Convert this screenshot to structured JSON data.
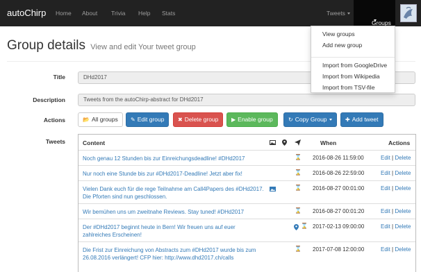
{
  "navbar": {
    "brand": "autoChirp",
    "items": [
      "Home",
      "About",
      "Trivia",
      "Help",
      "Stats"
    ],
    "tweets_label": "Tweets",
    "groups_label": "Groups",
    "accent": "#222222"
  },
  "dropdown": {
    "items": [
      "View groups",
      "Add new group",
      "Import from GoogleDrive",
      "Import from Wikipedia",
      "Import from TSV-file"
    ]
  },
  "header": {
    "title": "Group details",
    "subtitle": "View and edit Your tweet group"
  },
  "form": {
    "title_label": "Title",
    "title_value": "DHd2017",
    "description_label": "Description",
    "description_value": "Tweets from the autoChirp-abstract for DHd2017",
    "actions_label": "Actions",
    "tweets_label": "Tweets"
  },
  "buttons": {
    "all_groups": "All groups",
    "edit_group": "Edit group",
    "delete_group": "Delete group",
    "enable_group": "Enable group",
    "copy_group": "Copy Group",
    "add_tweet": "Add tweet"
  },
  "table": {
    "headers": {
      "content": "Content",
      "when": "When",
      "actions": "Actions"
    },
    "edit_label": "Edit",
    "separator": "|",
    "delete_label": "Delete",
    "rows": [
      {
        "content": "Noch genau 12 Stunden bis zur Einreichungsdeadline! #DHd2017",
        "when": "2016-08-26 11:59:00",
        "image": false,
        "geo": false
      },
      {
        "content": "Nur noch eine Stunde bis zur #DHd2017-Deadline! Jetzt aber fix!",
        "when": "2016-08-26 22:59:00",
        "image": false,
        "geo": false
      },
      {
        "content": "Vielen Dank euch für die rege Teilnahme am Call4Papers des #DHd2017. Die Pforten sind nun geschlossen.",
        "when": "2016-08-27 00:01:00",
        "image": true,
        "geo": false
      },
      {
        "content": "Wir bemühen uns um zweitnahe Reviews. Stay tuned! #DHd2017",
        "when": "2016-08-27 00:01:20",
        "image": false,
        "geo": false
      },
      {
        "content": "Der #DHd2017 beginnt heute in Bern! Wir freuen uns auf euer zahlreiches Erscheinen!",
        "when": "2017-02-13 09:00:00",
        "image": false,
        "geo": true
      },
      {
        "content": "Die Frist zur Einreichung von Abstracts zum #DHd2017 wurde bis zum 26.08.2016 verlängert! CFP hier: http://www.dhd2017.ch/calls",
        "when": "2017-07-08 12:00:00",
        "image": false,
        "geo": false
      }
    ]
  }
}
